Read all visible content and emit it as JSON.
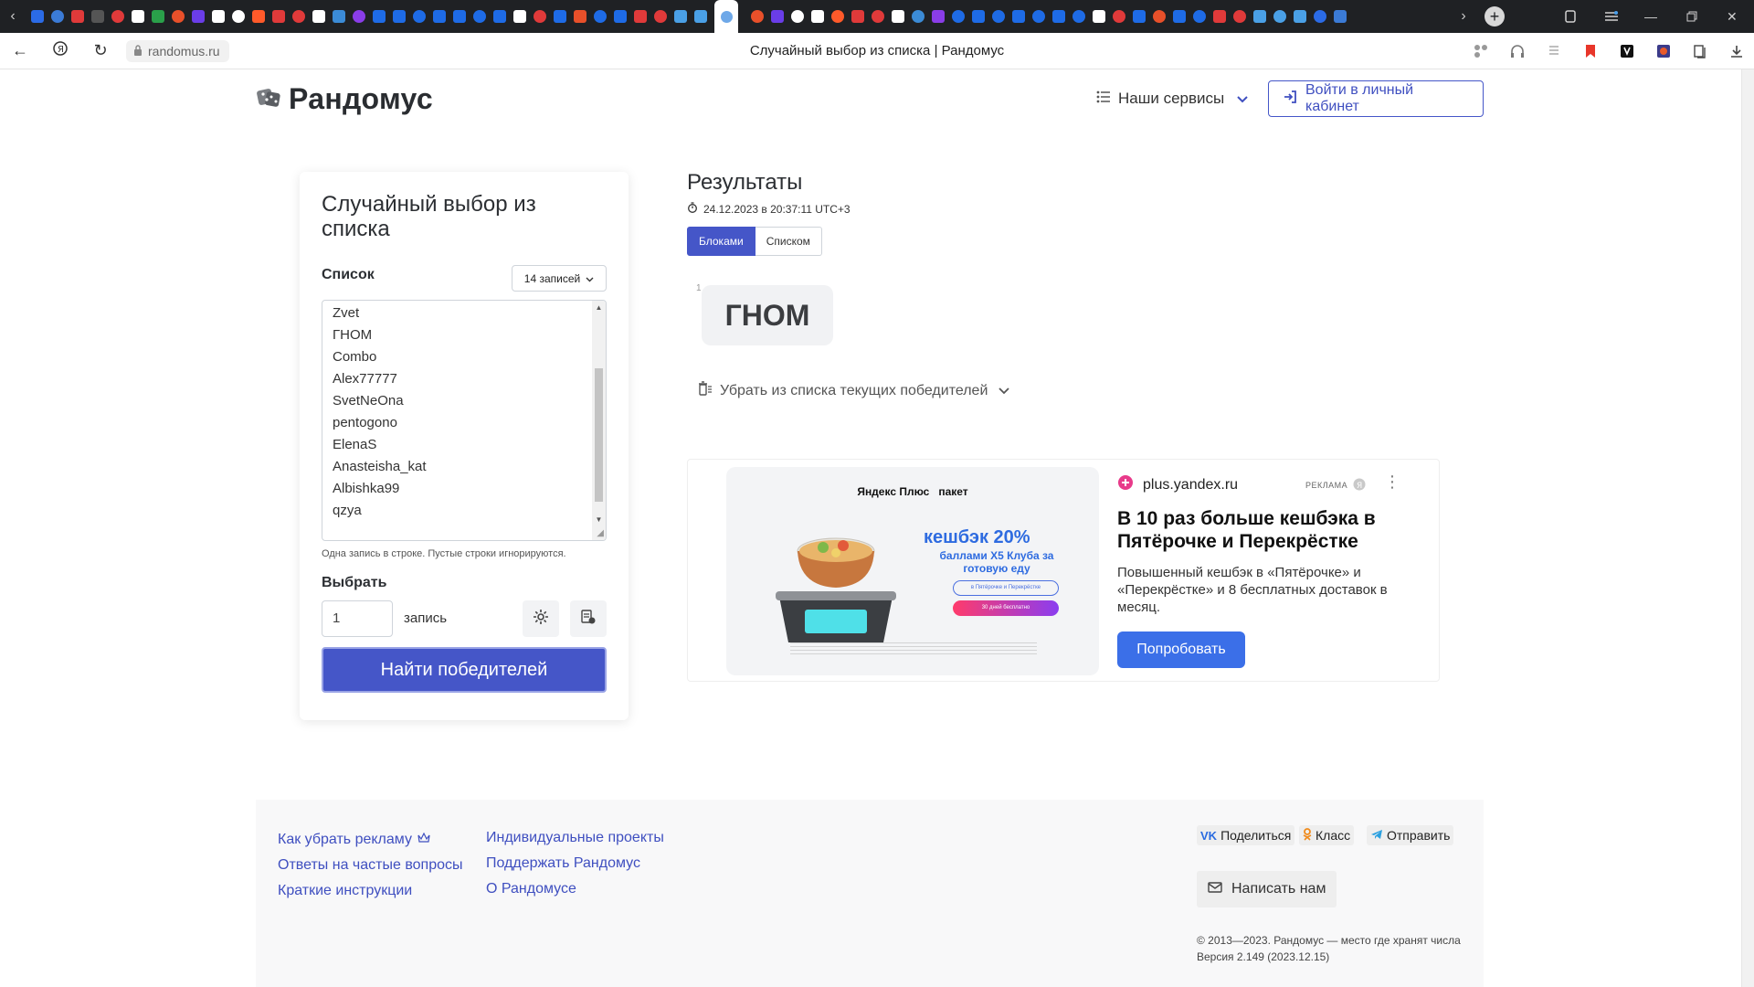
{
  "browser": {
    "tab_title": "Случайный выбор из списка | Рандомус",
    "url": "randomus.ru",
    "tab_colors": [
      "#2b6be6",
      "#3b7bd6",
      "#e03a3a",
      "#555",
      "#e03a3a",
      "#ffffff",
      "#2aa04a",
      "#e8502a",
      "#6a3de8",
      "#ffffff",
      "#ffffff",
      "#ff5a2a",
      "#e03a3a",
      "#e03a3a",
      "#ffffff",
      "#3b8bd6",
      "#8a3de8",
      "#1e6be6",
      "#1e6be6",
      "#1e6be6",
      "#1e6be6",
      "#1e6be6",
      "#1e6be6",
      "#1e6be6",
      "#ffffff",
      "#e03a3a",
      "#1e6be6",
      "#e8502a",
      "#1e6be6",
      "#1e6be6",
      "#e03a3a",
      "#e03a3a",
      "#4aa0e6",
      "#4aa0e6",
      "#4aa0e6"
    ]
  },
  "header": {
    "logo_text": "Рандомус",
    "services_label": "Наши сервисы",
    "login_label": "Войти в личный кабинет"
  },
  "form": {
    "title": "Случайный выбор из списка",
    "list_label": "Список",
    "count_label": "14 записей",
    "entries": [
      "Zvet",
      "ГНОМ",
      "Combo",
      "Alex77777",
      "SvetNeOna",
      "pentogono",
      "ElenaS",
      "Anasteisha_kat",
      "Albishka99",
      "qzya"
    ],
    "hint": "Одна запись в строке. Пустые строки игнорируются.",
    "pick_label": "Выбрать",
    "pick_count": "1",
    "unit_label": "запись",
    "find_button": "Найти победителей"
  },
  "results": {
    "title": "Результаты",
    "datetime": "24.12.2023 в 20:37:11 UTC+3",
    "view_blocks": "Блоками",
    "view_list": "Списком",
    "winner_index": "1",
    "winner": "ГНОМ",
    "remove_label": "Убрать из списка текущих победителей"
  },
  "ad": {
    "brand_left": "Яндекс Плюс",
    "brand_right": "пакет",
    "cashback_big": "кешбэк 20%",
    "cashback_small": "баллами X5 Клуба за готовую еду",
    "pill_1": "в Пятёрочке и Перекрёстке",
    "pill_2": "30 дней бесплатно",
    "domain": "plus.yandex.ru",
    "ad_mark": "РЕКЛАМА",
    "title": "В 10 раз больше кешбэка в Пятёрочке и Перекрёстке",
    "description": "Повышенный кешбэк в «Пятёрочке» и «Перекрёстке» и 8 бесплатных доставок в месяц.",
    "cta": "Попробовать"
  },
  "footer": {
    "col1": [
      "Как убрать рекламу",
      "Ответы на частые вопросы",
      "Краткие инструкции"
    ],
    "col2": [
      "Индивидуальные проекты",
      "Поддержать Рандомус",
      "О Рандомусе"
    ],
    "share_vk": "Поделиться",
    "share_ok": "Класс",
    "share_tg": "Отправить",
    "write_us": "Написать нам",
    "copyright": "© 2013—2023. Рандомус — место где хранят числа",
    "version": "Версия 2.149 (2023.12.15)"
  }
}
